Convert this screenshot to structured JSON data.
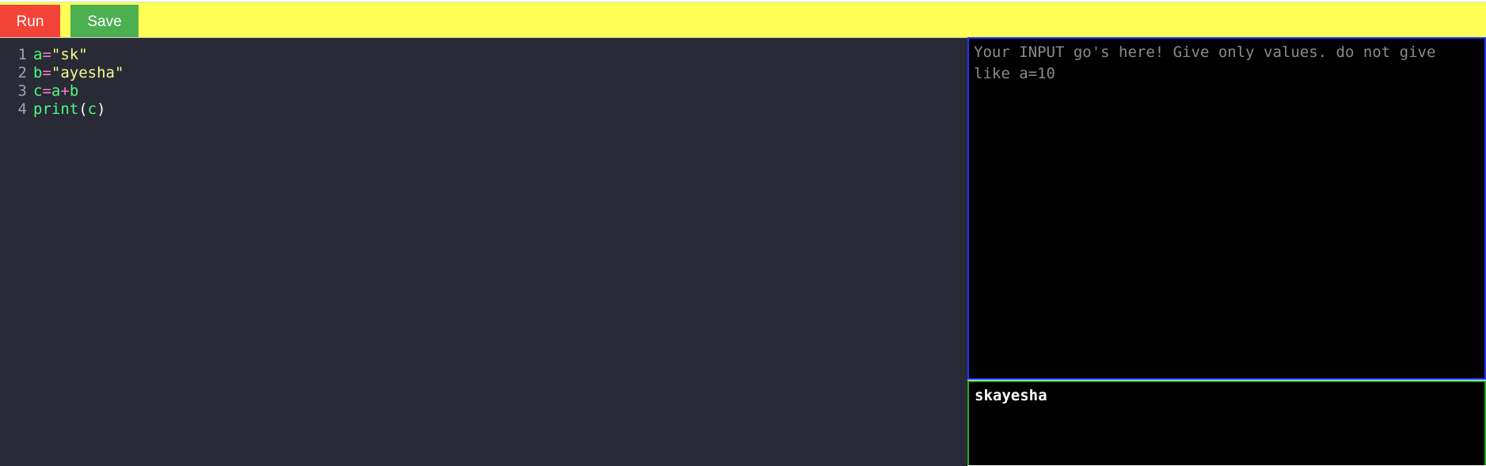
{
  "toolbar": {
    "run_label": "Run",
    "save_label": "Save",
    "background_color": "#ffff55",
    "run_color": "#f44336",
    "save_color": "#4caf50"
  },
  "editor": {
    "theme_background": "#282a36",
    "lines": [
      {
        "number": "1",
        "tokens": [
          {
            "text": "a",
            "kind": "var"
          },
          {
            "text": "=",
            "kind": "op"
          },
          {
            "text": "\"sk\"",
            "kind": "str"
          }
        ]
      },
      {
        "number": "2",
        "tokens": [
          {
            "text": "b",
            "kind": "var"
          },
          {
            "text": "=",
            "kind": "op"
          },
          {
            "text": "\"ayesha\"",
            "kind": "str"
          }
        ]
      },
      {
        "number": "3",
        "tokens": [
          {
            "text": "c",
            "kind": "var"
          },
          {
            "text": "=",
            "kind": "op"
          },
          {
            "text": "a",
            "kind": "var"
          },
          {
            "text": "+",
            "kind": "op"
          },
          {
            "text": "b",
            "kind": "var"
          }
        ]
      },
      {
        "number": "4",
        "tokens": [
          {
            "text": "print",
            "kind": "fn"
          },
          {
            "text": "(",
            "kind": "par"
          },
          {
            "text": "c",
            "kind": "var"
          },
          {
            "text": ")",
            "kind": "par"
          }
        ]
      }
    ]
  },
  "input": {
    "placeholder": "Your INPUT go's here! Give only values. do not give like a=10",
    "value": "",
    "border_color": "#2233ff"
  },
  "output": {
    "text": "skayesha",
    "border_color": "#22aa22"
  }
}
